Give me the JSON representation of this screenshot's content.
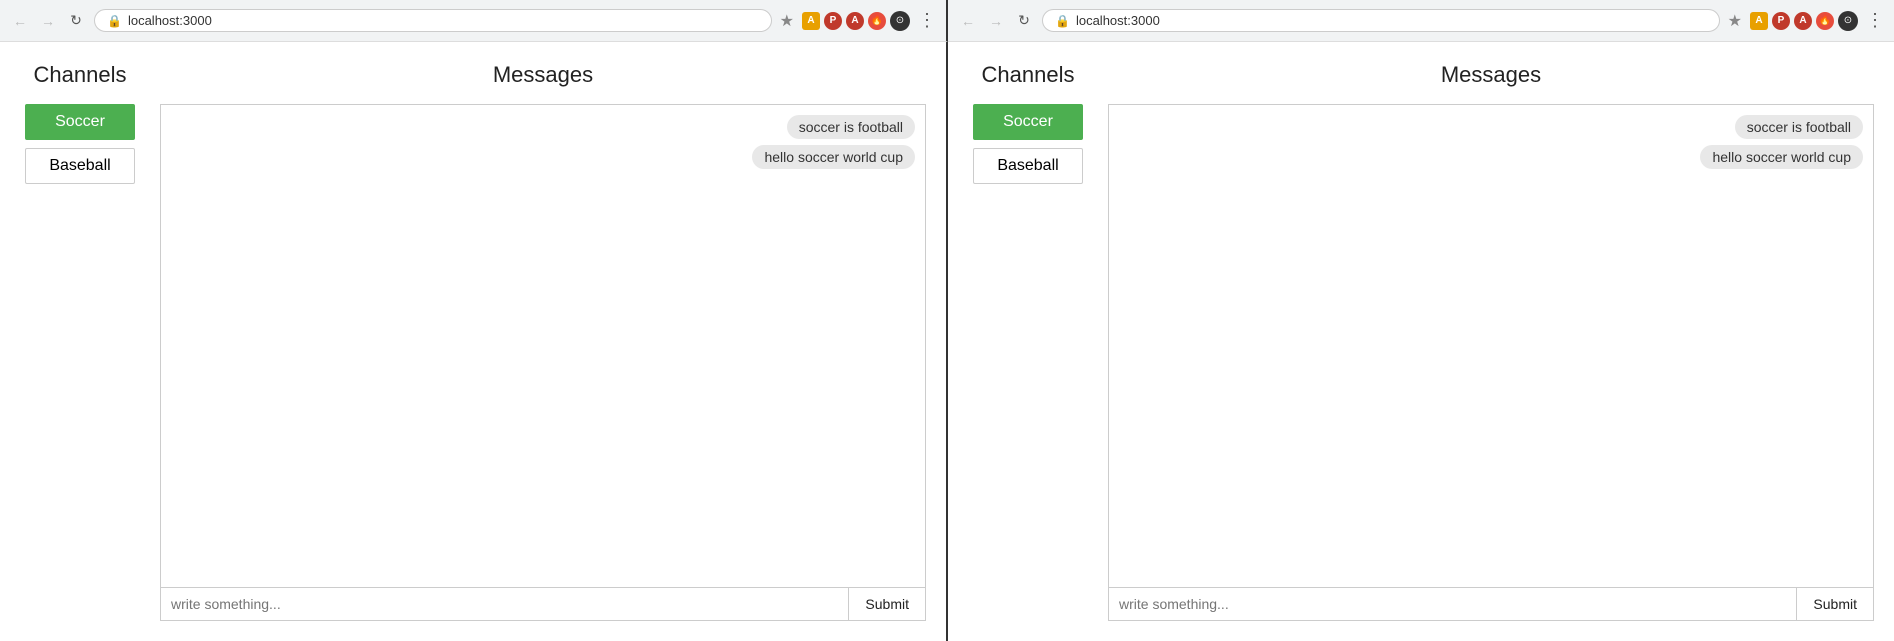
{
  "browser": {
    "url": "localhost:3000",
    "back_btn": "←",
    "forward_btn": "→",
    "refresh_btn": "↻",
    "star_label": "☆",
    "menu_label": "⋮"
  },
  "pane1": {
    "channels_title": "Channels",
    "messages_title": "Messages",
    "soccer_label": "Soccer",
    "baseball_label": "Baseball",
    "messages": [
      {
        "text": "soccer is football"
      },
      {
        "text": "hello soccer world cup"
      }
    ],
    "input_placeholder": "write something...",
    "submit_label": "Submit"
  },
  "pane2": {
    "channels_title": "Channels",
    "messages_title": "Messages",
    "soccer_label": "Soccer",
    "baseball_label": "Baseball",
    "messages": [
      {
        "text": "soccer is football"
      },
      {
        "text": "hello soccer world cup"
      }
    ],
    "input_placeholder": "write something...",
    "submit_label": "Submit"
  }
}
